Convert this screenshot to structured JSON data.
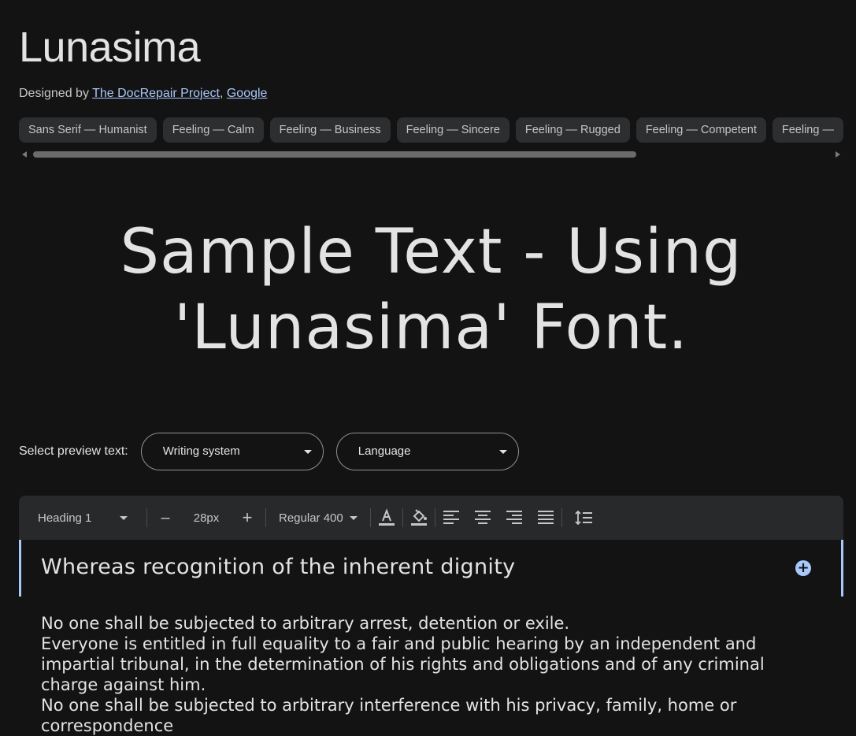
{
  "font": {
    "name": "Lunasima",
    "designed_by_prefix": "Designed by",
    "designers": [
      "The DocRepair Project",
      "Google"
    ],
    "separator": ","
  },
  "tags": [
    "Sans Serif — Humanist",
    "Feeling — Calm",
    "Feeling — Business",
    "Feeling — Sincere",
    "Feeling — Rugged",
    "Feeling — Competent",
    "Feeling — "
  ],
  "sample_text": "Sample Text - Using 'Lunasima' Font.",
  "preview": {
    "label": "Select preview text:",
    "writing_system": "Writing system",
    "language": "Language"
  },
  "toolbar": {
    "style_select": "Heading 1",
    "decrease": "–",
    "size": "28px",
    "increase": "+",
    "weight_select": "Regular 400"
  },
  "editor": {
    "heading": "Whereas recognition of the inherent dignity",
    "add": "+",
    "paragraphs": [
      "No one shall be subjected to arbitrary arrest, detention or exile.",
      "Everyone is entitled in full equality to a fair and public hearing by an independent and impartial tribunal, in the determination of his rights and obligations and of any criminal charge against him.",
      "No one shall be subjected to arbitrary interference with his privacy, family, home or correspondence"
    ]
  },
  "colors": {
    "background": "#131313",
    "chip": "#2d2e30",
    "accent": "#a8c7fa",
    "toolbar": "#28292b"
  },
  "icons": {
    "text_color": "text-color-icon",
    "fill_color": "fill-color-icon",
    "align_left": "align-left-icon",
    "align_center": "align-center-icon",
    "align_right": "align-right-icon",
    "align_justify": "align-justify-icon",
    "line_height": "line-height-icon",
    "add": "add-circle-icon"
  }
}
